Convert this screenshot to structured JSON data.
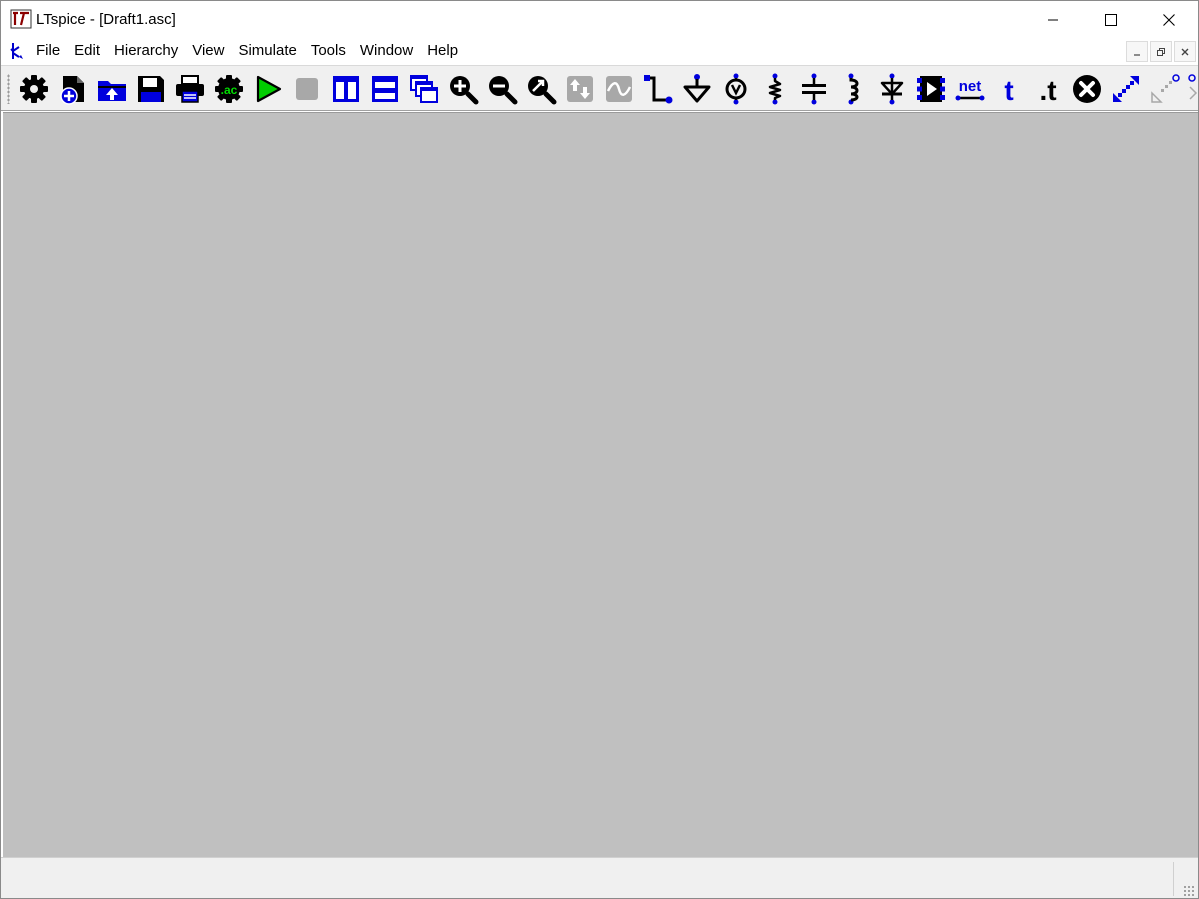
{
  "window": {
    "title": "LTspice - [Draft1.asc]",
    "controls": {
      "minimize": "minimize",
      "maximize": "maximize",
      "close": "close"
    }
  },
  "menubar": {
    "items": [
      "File",
      "Edit",
      "Hierarchy",
      "View",
      "Simulate",
      "Tools",
      "Window",
      "Help"
    ]
  },
  "toolbar": {
    "ac_label": ".ac",
    "net_label": "net",
    "text_label": "t",
    "spice_label": ".t",
    "colors": {
      "blue": "#0000dd",
      "green": "#00cc00",
      "black": "#000000",
      "disabled": "#a8a8a8"
    }
  },
  "statusbar": {
    "text": ""
  }
}
